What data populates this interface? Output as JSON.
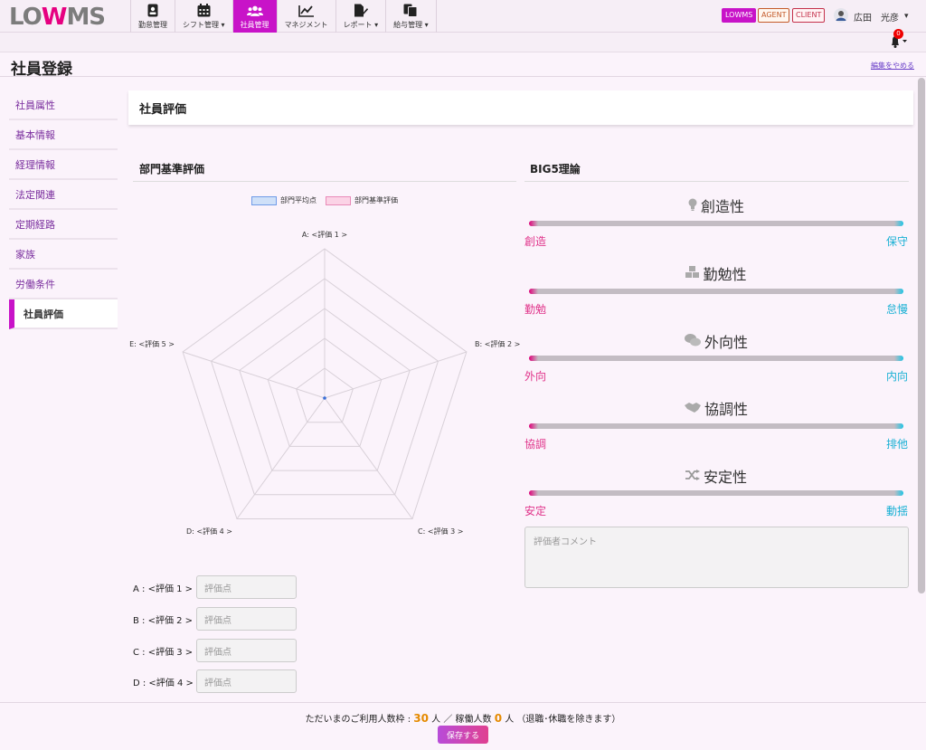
{
  "app": {
    "logo_left": "LO",
    "logo_mid": "W",
    "logo_right": "MS"
  },
  "nav": [
    {
      "label": "勤怠管理",
      "icon": "badge-icon"
    },
    {
      "label": "シフト管理 ▾",
      "icon": "calendar-icon"
    },
    {
      "label": "社員管理",
      "icon": "users-icon",
      "active": true
    },
    {
      "label": "マネジメント",
      "icon": "line-chart-icon"
    },
    {
      "label": "レポート ▾",
      "icon": "file-edit-icon"
    },
    {
      "label": "給与管理 ▾",
      "icon": "documents-icon"
    }
  ],
  "roles": {
    "lowms": "LOWMS",
    "agent": "AGENT",
    "client": "CLIENT"
  },
  "user": {
    "name": "広田　光彦",
    "caret": "▾"
  },
  "notifications": {
    "count": "0"
  },
  "page": {
    "title": "社員登録",
    "stop_edit": "編集をやめる"
  },
  "sidebar": [
    {
      "label": "社員属性"
    },
    {
      "label": "基本情報"
    },
    {
      "label": "経理情報"
    },
    {
      "label": "法定関連"
    },
    {
      "label": "定期経路"
    },
    {
      "label": "家族"
    },
    {
      "label": "労働条件"
    },
    {
      "label": "社員評価",
      "active": true
    }
  ],
  "section": {
    "title": "社員評価"
  },
  "dept_eval": {
    "title": "部門基準評価",
    "legend": {
      "avg": "部門平均点",
      "dept": "部門基準評価"
    },
    "axes": [
      "A: <評価 1 >",
      "B: <評価 2 >",
      "C: <評価 3 >",
      "D: <評価 4 >",
      "E: <評価 5 >"
    ],
    "rows": [
      {
        "label": "A : <評価 1 >",
        "placeholder": "評価点"
      },
      {
        "label": "B : <評価 2 >",
        "placeholder": "評価点"
      },
      {
        "label": "C : <評価 3 >",
        "placeholder": "評価点"
      },
      {
        "label": "D : <評価 4 >",
        "placeholder": "評価点"
      }
    ]
  },
  "big5": {
    "title": "BIG5理論",
    "traits": [
      {
        "name": "創造性",
        "icon": "lightbulb-icon",
        "left": "創造",
        "right": "保守"
      },
      {
        "name": "勤勉性",
        "icon": "cubes-icon",
        "left": "勤勉",
        "right": "怠慢"
      },
      {
        "name": "外向性",
        "icon": "comments-icon",
        "left": "外向",
        "right": "内向"
      },
      {
        "name": "協調性",
        "icon": "handshake-icon",
        "left": "協調",
        "right": "排他"
      },
      {
        "name": "安定性",
        "icon": "shuffle-icon",
        "left": "安定",
        "right": "動揺"
      }
    ],
    "comment_placeholder": "評価者コメント"
  },
  "footer": {
    "prefix": "ただいまのご利用人数枠 : ",
    "quota": "30",
    "mid": " 人 ／ 稼働人数 ",
    "active": "0",
    "suffix": " 人 （退職･休職を除きます）",
    "save": "保存する"
  }
}
